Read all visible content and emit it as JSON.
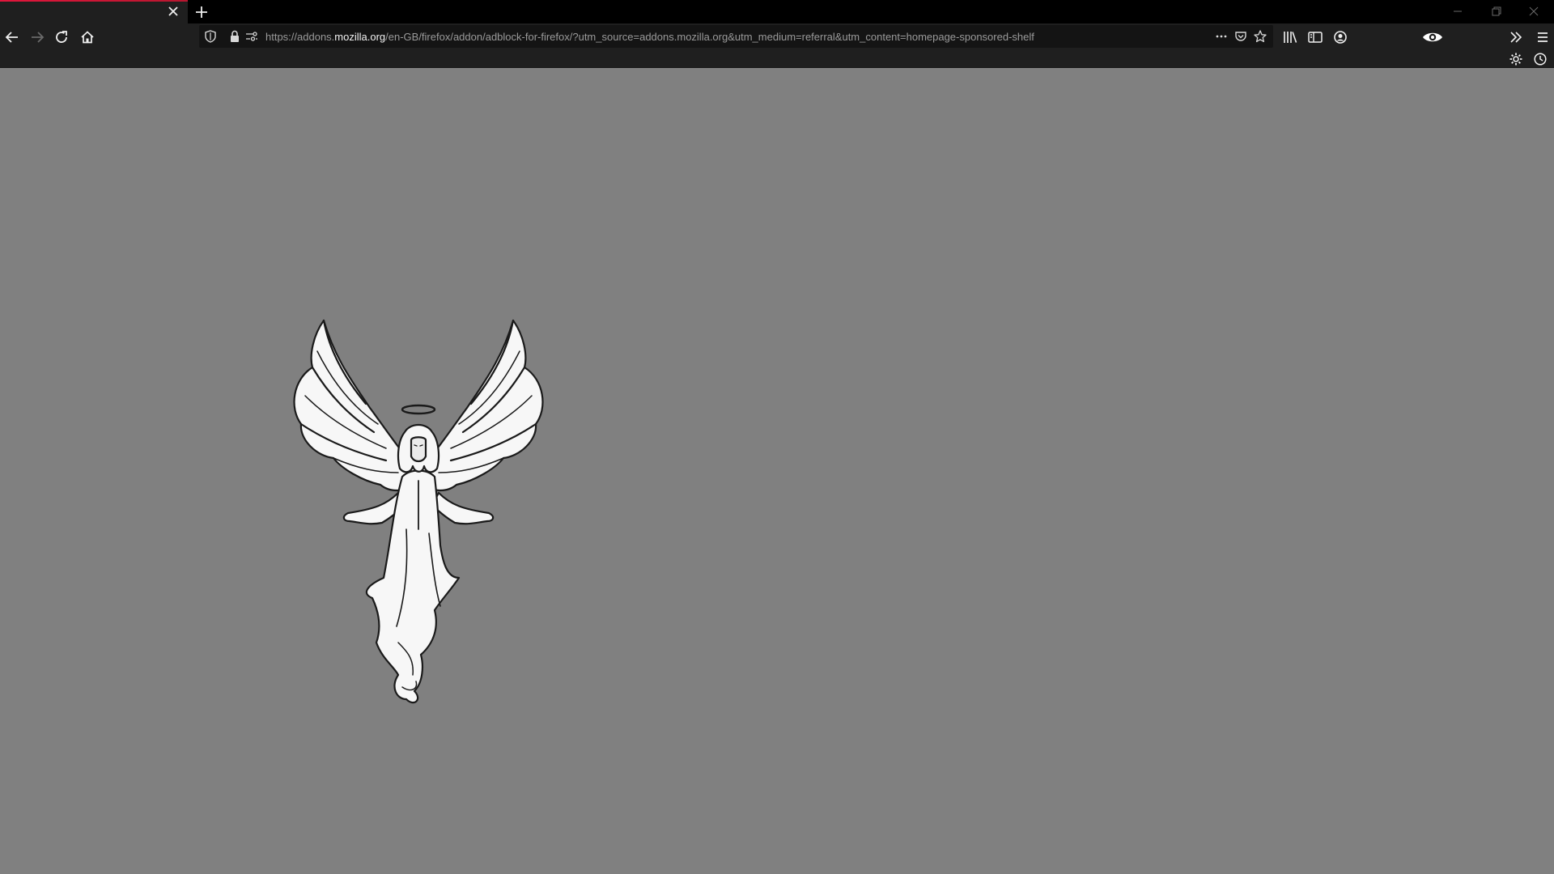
{
  "browser": {
    "active_tab": {
      "close_tooltip": "×",
      "accent_color": "#e1163c"
    },
    "new_tab_symbol": "+"
  },
  "urlbar": {
    "url_prefix": "https://addons.",
    "url_host": "mozilla.org",
    "url_path": "/en-GB/firefox/addon/adblock-for-firefox/?utm_source=addons.mozilla.org&utm_medium=referral&utm_content=homepage-sponsored-shelf"
  },
  "icons": {
    "back": "back-arrow-icon",
    "forward": "forward-arrow-icon",
    "reload": "reload-icon",
    "home": "home-icon",
    "shield": "tracking-protection-shield-icon",
    "lock": "lock-icon",
    "permissions": "permissions-icon",
    "more": "page-actions-more-icon",
    "pocket": "pocket-icon",
    "bookmark": "bookmark-star-icon",
    "library": "library-icon",
    "sidebar": "sidebar-icon",
    "account": "account-icon",
    "extension": "eye-extension-icon",
    "overflow": "overflow-chevron-icon",
    "menu": "hamburger-menu-icon",
    "gear": "gear-icon",
    "clock": "clock-icon"
  },
  "page": {
    "background_color": "#808080",
    "image": "angel-illustration"
  }
}
